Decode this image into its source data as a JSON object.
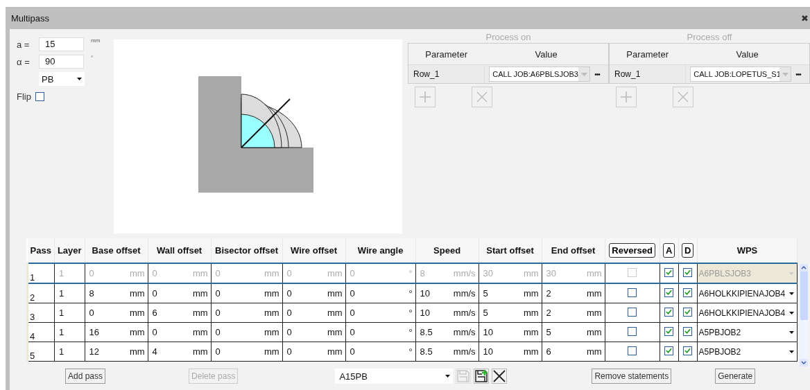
{
  "window": {
    "title": "Multipass",
    "close": "✖"
  },
  "params": {
    "fields": [
      {
        "label": "a =",
        "value": "15",
        "unit": "mm"
      },
      {
        "label": "α =",
        "value": "90",
        "unit": "°"
      }
    ],
    "position": {
      "value": "PB"
    },
    "flip": {
      "label": "Flip",
      "checked": false
    }
  },
  "process_tables": [
    {
      "title": "Process on",
      "columns": [
        "Parameter",
        "Value"
      ],
      "rows": [
        {
          "parameter": "Row_1",
          "value": "CALL JOB:A6PBLSJOB3",
          "more": "•••"
        }
      ]
    },
    {
      "title": "Process off",
      "columns": [
        "Parameter",
        "Value"
      ],
      "rows": [
        {
          "parameter": "Row_1",
          "value": "CALL JOB:LOPETUS_S1",
          "more": "•••"
        }
      ]
    }
  ],
  "passes": {
    "columns": [
      {
        "label": "Pass",
        "kind": "text"
      },
      {
        "label": "Layer",
        "kind": "text"
      },
      {
        "label": "Base offset",
        "kind": "text"
      },
      {
        "label": "Wall offset",
        "kind": "text"
      },
      {
        "label": "Bisector offset",
        "kind": "text"
      },
      {
        "label": "Wire offset",
        "kind": "text"
      },
      {
        "label": "Wire angle",
        "kind": "text"
      },
      {
        "label": "Speed",
        "kind": "text"
      },
      {
        "label": "Start offset",
        "kind": "text"
      },
      {
        "label": "End offset",
        "kind": "text"
      },
      {
        "label": "Reversed",
        "kind": "button"
      },
      {
        "label": "A",
        "kind": "button"
      },
      {
        "label": "D",
        "kind": "button"
      },
      {
        "label": "WPS",
        "kind": "text"
      }
    ],
    "rows": [
      {
        "pass": "1",
        "layer": "1",
        "disabled": true,
        "values": [
          {
            "value": "0",
            "unit": "mm"
          },
          {
            "value": "0",
            "unit": "mm"
          },
          {
            "value": "0",
            "unit": "mm"
          },
          {
            "value": "0",
            "unit": "mm"
          },
          {
            "value": "0",
            "unit": "°"
          },
          {
            "value": "8",
            "unit": "mm/s"
          },
          {
            "value": "30",
            "unit": "mm"
          },
          {
            "value": "30",
            "unit": "mm"
          }
        ],
        "reversed": false,
        "a": true,
        "d": true,
        "wps": "A6PBLSJOB3"
      },
      {
        "pass": "2",
        "layer": "1",
        "disabled": false,
        "values": [
          {
            "value": "8",
            "unit": "mm"
          },
          {
            "value": "0",
            "unit": "mm"
          },
          {
            "value": "0",
            "unit": "mm"
          },
          {
            "value": "0",
            "unit": "mm"
          },
          {
            "value": "0",
            "unit": "°"
          },
          {
            "value": "10",
            "unit": "mm/s"
          },
          {
            "value": "5",
            "unit": "mm"
          },
          {
            "value": "2",
            "unit": "mm"
          }
        ],
        "reversed": false,
        "a": true,
        "d": true,
        "wps": "A6HOLKKIPIENAJOB4"
      },
      {
        "pass": "3",
        "layer": "1",
        "disabled": false,
        "values": [
          {
            "value": "0",
            "unit": "mm"
          },
          {
            "value": "6",
            "unit": "mm"
          },
          {
            "value": "0",
            "unit": "mm"
          },
          {
            "value": "0",
            "unit": "mm"
          },
          {
            "value": "0",
            "unit": "°"
          },
          {
            "value": "10",
            "unit": "mm/s"
          },
          {
            "value": "5",
            "unit": "mm"
          },
          {
            "value": "2",
            "unit": "mm"
          }
        ],
        "reversed": false,
        "a": true,
        "d": true,
        "wps": "A6HOLKKIPIENAJOB4"
      },
      {
        "pass": "4",
        "layer": "1",
        "disabled": false,
        "values": [
          {
            "value": "16",
            "unit": "mm"
          },
          {
            "value": "0",
            "unit": "mm"
          },
          {
            "value": "0",
            "unit": "mm"
          },
          {
            "value": "0",
            "unit": "mm"
          },
          {
            "value": "0",
            "unit": "°"
          },
          {
            "value": "8.5",
            "unit": "mm/s"
          },
          {
            "value": "10",
            "unit": "mm"
          },
          {
            "value": "5",
            "unit": "mm"
          }
        ],
        "reversed": false,
        "a": true,
        "d": true,
        "wps": "A5PBJOB2"
      },
      {
        "pass": "5",
        "layer": "1",
        "disabled": false,
        "values": [
          {
            "value": "12",
            "unit": "mm"
          },
          {
            "value": "4",
            "unit": "mm"
          },
          {
            "value": "0",
            "unit": "mm"
          },
          {
            "value": "0",
            "unit": "mm"
          },
          {
            "value": "0",
            "unit": "°"
          },
          {
            "value": "8.5",
            "unit": "mm/s"
          },
          {
            "value": "10",
            "unit": "mm"
          },
          {
            "value": "6",
            "unit": "mm"
          }
        ],
        "reversed": false,
        "a": true,
        "d": true,
        "wps": "A5PBJOB2"
      }
    ]
  },
  "footer": {
    "add_pass": {
      "label": "Add pass",
      "disabled": false
    },
    "delete_pass": {
      "label": "Delete pass",
      "disabled": true
    },
    "preset": {
      "value": "A15PB"
    },
    "save_disabled": true,
    "remove_statements": {
      "label": "Remove statements",
      "disabled": false
    },
    "generate": {
      "label": "Generate",
      "disabled": false
    }
  }
}
